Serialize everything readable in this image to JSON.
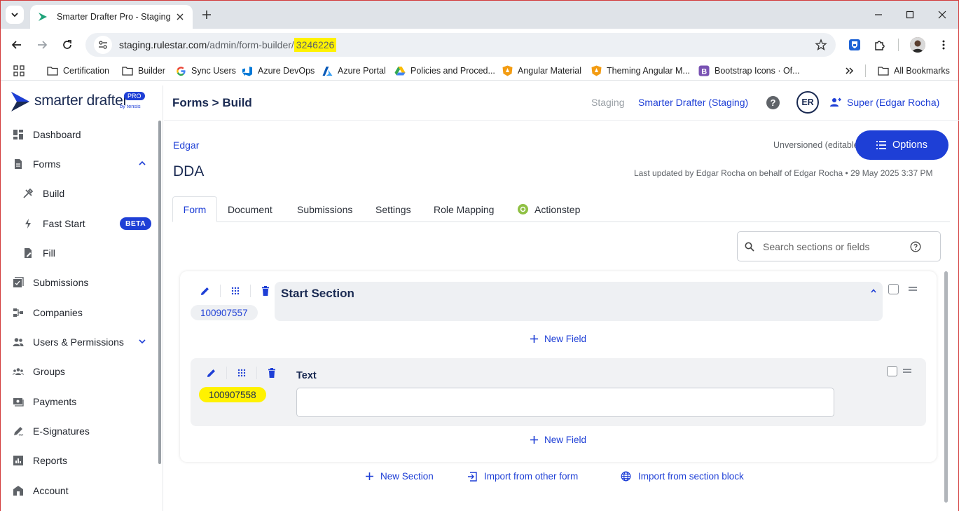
{
  "browser": {
    "tab_title": "Smarter Drafter Pro - Staging",
    "url_host": "staging.rulestar.com",
    "url_path": "/admin/form-builder/",
    "url_highlight": "3246226",
    "bookmarks": [
      {
        "label": "Certification",
        "icon": "folder-icon"
      },
      {
        "label": "Builder",
        "icon": "folder-icon"
      },
      {
        "label": "Sync Users",
        "icon": "google-icon"
      },
      {
        "label": "Azure DevOps",
        "icon": "azure-devops-icon"
      },
      {
        "label": "Azure Portal",
        "icon": "azure-icon"
      },
      {
        "label": "Policies and Proced...",
        "icon": "drive-icon"
      },
      {
        "label": "Angular Material",
        "icon": "shield-icon"
      },
      {
        "label": "Theming Angular M...",
        "icon": "shield-icon"
      },
      {
        "label": "Bootstrap Icons · Of...",
        "icon": "bootstrap-icon"
      }
    ],
    "all_bookmarks": "All Bookmarks"
  },
  "sidebar": {
    "logo_text": "smarter drafter",
    "logo_badge": "PRO",
    "logo_by": "by tensis",
    "items": [
      {
        "label": "Dashboard",
        "icon": "dashboard-icon"
      },
      {
        "label": "Forms",
        "icon": "document-icon",
        "expanded": true
      },
      {
        "label": "Build",
        "icon": "tools-icon",
        "sub": true
      },
      {
        "label": "Fast Start",
        "icon": "bolt-icon",
        "sub": true,
        "badge": "BETA"
      },
      {
        "label": "Fill",
        "icon": "fill-icon",
        "sub": true
      },
      {
        "label": "Submissions",
        "icon": "submissions-icon"
      },
      {
        "label": "Companies",
        "icon": "companies-icon"
      },
      {
        "label": "Users & Permissions",
        "icon": "users-icon",
        "expanded": false
      },
      {
        "label": "Groups",
        "icon": "groups-icon"
      },
      {
        "label": "Payments",
        "icon": "payments-icon"
      },
      {
        "label": "E-Signatures",
        "icon": "signature-icon"
      },
      {
        "label": "Reports",
        "icon": "reports-icon"
      },
      {
        "label": "Account",
        "icon": "account-icon"
      }
    ]
  },
  "header": {
    "title": "Forms > Build",
    "environment": "Staging",
    "environment_link": "Smarter Drafter (Staging)",
    "help": "?",
    "avatar_initials": "ER",
    "user": "Super (Edgar Rocha)"
  },
  "form": {
    "owner": "Edgar",
    "title": "DDA",
    "version_status": "Unversioned (editable)",
    "options_label": "Options",
    "last_updated": "Last updated by Edgar Rocha on behalf of Edgar Rocha  •  29 May 2025 3:37 PM",
    "tabs": [
      "Form",
      "Document",
      "Submissions",
      "Settings",
      "Role Mapping",
      "Actionstep"
    ],
    "active_tab": "Form",
    "search_placeholder": "Search sections or fields",
    "section": {
      "id": "100907557",
      "title": "Start Section"
    },
    "field": {
      "id": "100907558",
      "label": "Text",
      "value": ""
    },
    "new_field_label": "New Field",
    "new_section_label": "New Section",
    "import_form_label": "Import from other form",
    "import_block_label": "Import from section block"
  },
  "colors": {
    "brand_blue": "#1e3fd6",
    "navy": "#1a2a52",
    "highlight": "#fff200"
  }
}
